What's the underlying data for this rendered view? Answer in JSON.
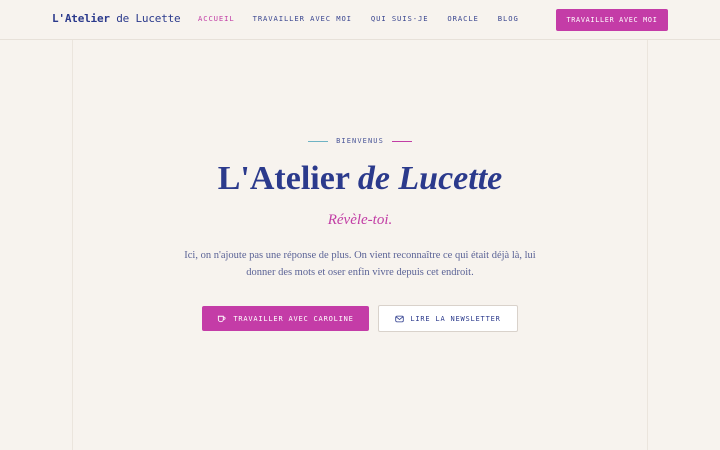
{
  "header": {
    "logo_strong": "L'Atelier",
    "logo_rest": " de Lucette",
    "nav": [
      {
        "label": "ACCUEIL",
        "active": true
      },
      {
        "label": "TRAVAILLER AVEC MOI",
        "active": false
      },
      {
        "label": "QUI SUIS-JE",
        "active": false
      },
      {
        "label": "ORACLE",
        "active": false
      },
      {
        "label": "BLOG",
        "active": false
      }
    ],
    "cta_label": "TRAVAILLER AVEC MOI"
  },
  "hero": {
    "eyebrow": "BIENVENUS",
    "title_main": "L'Atelier ",
    "title_italic": "de Lucette",
    "tagline": "Révèle-toi.",
    "intro": "Ici, on n'ajoute pas une réponse de plus. On vient reconnaître ce qui était déjà là, lui donner des mots et oser enfin vivre depuis cet endroit.",
    "primary_button": {
      "label": "TRAVAILLER AVEC CAROLINE",
      "icon": "cup-icon"
    },
    "secondary_button": {
      "label": "LIRE LA NEWSLETTER",
      "icon": "mail-icon"
    }
  },
  "colors": {
    "accent": "#c43ca7",
    "primary_text": "#2b3a8c",
    "background": "#f7f3ee",
    "eyebrow_line_left": "#6fb3c4"
  }
}
